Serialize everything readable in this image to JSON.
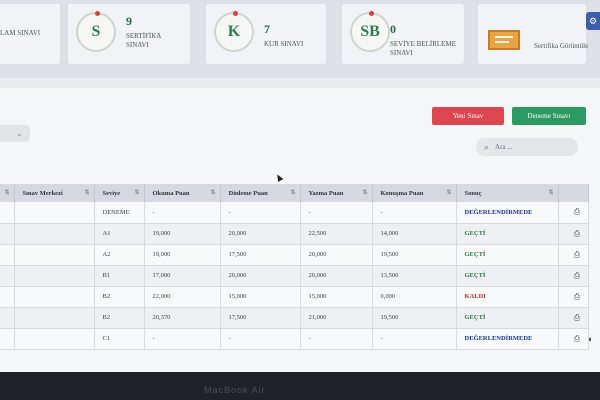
{
  "stats": [
    {
      "initials": "",
      "count": "",
      "label": "LAM SINAVI"
    },
    {
      "initials": "S",
      "count": "9",
      "label": "SERTİFİKA SINAVI"
    },
    {
      "initials": "K",
      "count": "7",
      "label": "KUR SINAVI"
    },
    {
      "initials": "SB",
      "count": "0",
      "label": "SEVİYE BELİRLEME SINAVI"
    },
    {
      "initials": "",
      "count": "",
      "label": "Sertifika Görüntüle"
    }
  ],
  "toolbar": {
    "new_exam_label": "Yeni Sınav",
    "trial_exam_label": "Deneme Sınavı"
  },
  "search": {
    "placeholder": "Ara ..."
  },
  "table": {
    "columns": [
      "Sınav Merkezi",
      "Seviye",
      "Okuma Puan",
      "Dinleme Puan",
      "Yazma Puan",
      "Konuşma Puan",
      "Sonuç"
    ],
    "rows": [
      {
        "merkez": "",
        "seviye": "DENEME",
        "okuma": "-",
        "dinleme": "-",
        "yazma": "-",
        "konusma": "-",
        "sonuc": "DEĞERLENDİRMEDE",
        "status": "pending"
      },
      {
        "merkez": "",
        "seviye": "A1",
        "okuma": "19,000",
        "dinleme": "20,000",
        "yazma": "22,500",
        "konusma": "14,000",
        "sonuc": "GEÇTİ",
        "status": "pass"
      },
      {
        "merkez": "",
        "seviye": "A2",
        "okuma": "19,000",
        "dinleme": "17,500",
        "yazma": "20,000",
        "konusma": "19,500",
        "sonuc": "GEÇTİ",
        "status": "pass"
      },
      {
        "merkez": "",
        "seviye": "B1",
        "okuma": "17,000",
        "dinleme": "20,000",
        "yazma": "20,000",
        "konusma": "13,500",
        "sonuc": "GEÇTİ",
        "status": "pass"
      },
      {
        "merkez": "",
        "seviye": "B2",
        "okuma": "22,000",
        "dinleme": "15,000",
        "yazma": "15,000",
        "konusma": "0,000",
        "sonuc": "KALDI",
        "status": "fail"
      },
      {
        "merkez": "",
        "seviye": "B2",
        "okuma": "20,370",
        "dinleme": "17,500",
        "yazma": "21,000",
        "konusma": "19,500",
        "sonuc": "GEÇTİ",
        "status": "pass"
      },
      {
        "merkez": "",
        "seviye": "C1",
        "okuma": "-",
        "dinleme": "-",
        "yazma": "-",
        "konusma": "-",
        "sonuc": "DEĞERLENDİRMEDE",
        "status": "pending"
      }
    ]
  },
  "device": {
    "label": "MacBook Air"
  },
  "colors": {
    "new_exam": "#dc4650",
    "trial_exam": "#2e9a63",
    "pass": "#2b7a45",
    "fail": "#c72d2d",
    "pending": "#203a8c"
  }
}
